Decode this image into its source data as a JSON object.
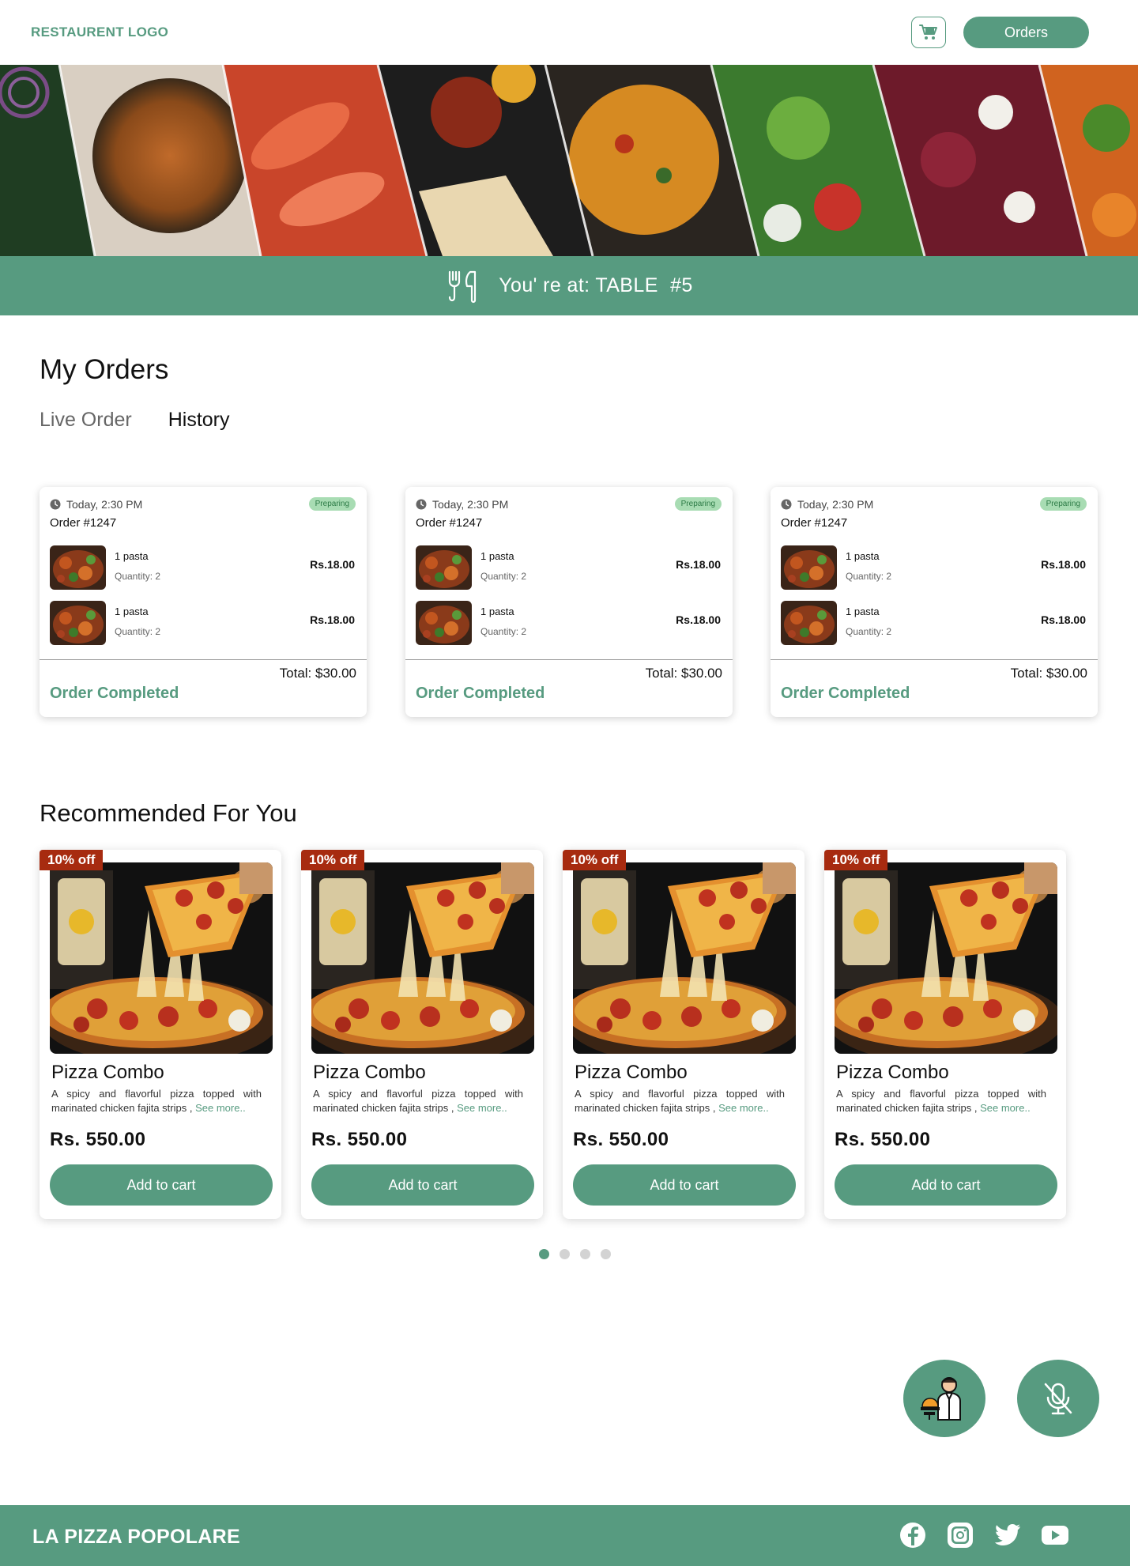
{
  "header": {
    "logo_text": "RESTAURENT LOGO",
    "cart_icon": "cart-icon",
    "orders_label": "Orders"
  },
  "table_bar": {
    "icon": "fork-knife-icon",
    "label": "You' re at: TABLE",
    "table_number": "#5"
  },
  "my_orders": {
    "title": "My Orders",
    "tabs": [
      {
        "label": "Live Order",
        "active": false
      },
      {
        "label": "History",
        "active": true
      }
    ],
    "orders": [
      {
        "time": "Today, 2:30 PM",
        "status_badge": "Preparing",
        "order_number": "Order #1247",
        "items": [
          {
            "name": "1 pasta",
            "quantity": "Quantity: 2",
            "price": "Rs.18.00"
          },
          {
            "name": "1 pasta",
            "quantity": "Quantity: 2",
            "price": "Rs.18.00"
          }
        ],
        "total": "Total: $30.00",
        "status": "Order Completed"
      },
      {
        "time": "Today, 2:30 PM",
        "status_badge": "Preparing",
        "order_number": "Order #1247",
        "items": [
          {
            "name": "1 pasta",
            "quantity": "Quantity: 2",
            "price": "Rs.18.00"
          },
          {
            "name": "1 pasta",
            "quantity": "Quantity: 2",
            "price": "Rs.18.00"
          }
        ],
        "total": "Total: $30.00",
        "status": "Order Completed"
      },
      {
        "time": "Today, 2:30 PM",
        "status_badge": "Preparing",
        "order_number": "Order #1247",
        "items": [
          {
            "name": "1 pasta",
            "quantity": "Quantity: 2",
            "price": "Rs.18.00"
          },
          {
            "name": "1 pasta",
            "quantity": "Quantity: 2",
            "price": "Rs.18.00"
          }
        ],
        "total": "Total: $30.00",
        "status": "Order Completed"
      }
    ]
  },
  "recommended": {
    "title": "Recommended For You",
    "items": [
      {
        "discount": "10% off",
        "name": "Pizza Combo",
        "description": "A spicy and flavorful pizza topped with marinated chicken fajita strips ,",
        "see_more": "See more..",
        "price": "Rs. 550.00",
        "button": "Add to cart"
      },
      {
        "discount": "10% off",
        "name": "Pizza Combo",
        "description": "A spicy and flavorful pizza topped with marinated chicken fajita strips ,",
        "see_more": "See more..",
        "price": "Rs. 550.00",
        "button": "Add to cart"
      },
      {
        "discount": "10% off",
        "name": "Pizza Combo",
        "description": "A spicy and flavorful pizza topped with marinated chicken fajita strips ,",
        "see_more": "See more..",
        "price": "Rs. 550.00",
        "button": "Add to cart"
      },
      {
        "discount": "10% off",
        "name": "Pizza Combo",
        "description": "A spicy and flavorful pizza topped with marinated chicken fajita strips ,",
        "see_more": "See more..",
        "price": "Rs. 550.00",
        "button": "Add to cart"
      }
    ],
    "carousel": {
      "pages": 4,
      "active_page": 1
    }
  },
  "floating": {
    "waiter_icon": "waiter-icon",
    "mic_icon": "mic-off-icon"
  },
  "footer": {
    "brand": "LA PIZZA POPOLARE",
    "social_icons": [
      "facebook-icon",
      "instagram-icon",
      "twitter-icon",
      "youtube-icon"
    ]
  },
  "colors": {
    "primary": "#579b80",
    "discount": "#a72b10",
    "badge_bg": "#a8dcb3",
    "badge_text": "#2b7a45"
  }
}
